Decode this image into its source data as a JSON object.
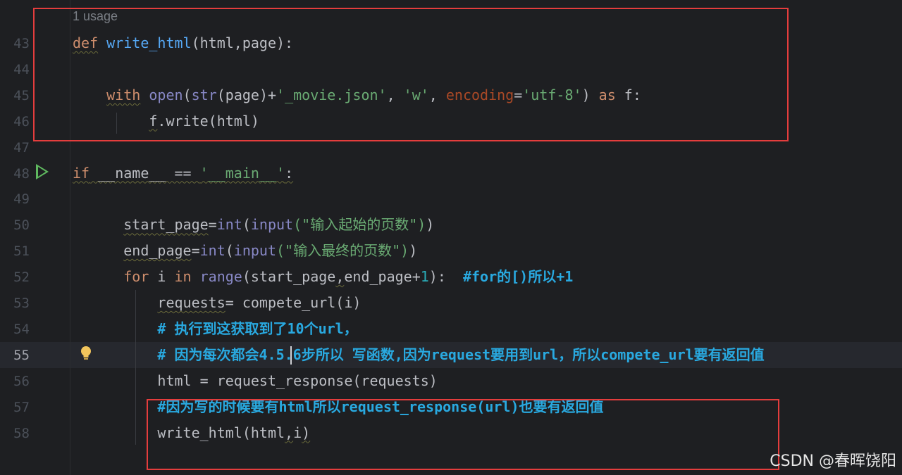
{
  "editor": {
    "usage_hint": "1 usage",
    "lines": [
      {
        "num": "43",
        "tokens": [
          {
            "t": "def",
            "c": "kw squig"
          },
          {
            "t": " "
          },
          {
            "t": "write_html",
            "c": "fn"
          },
          {
            "t": "(html,page):"
          }
        ]
      },
      {
        "num": "44",
        "tokens": []
      },
      {
        "num": "45",
        "tokens": [
          {
            "t": "    "
          },
          {
            "t": "with",
            "c": "kw squig"
          },
          {
            "t": " "
          },
          {
            "t": "open",
            "c": "bi"
          },
          {
            "t": "("
          },
          {
            "t": "str",
            "c": "bi"
          },
          {
            "t": "(page)+"
          },
          {
            "t": "'_movie.json'",
            "c": "str"
          },
          {
            "t": ", "
          },
          {
            "t": "'w'",
            "c": "str"
          },
          {
            "t": ", "
          },
          {
            "t": "encoding",
            "c": "param"
          },
          {
            "t": "="
          },
          {
            "t": "'utf-8'",
            "c": "str"
          },
          {
            "t": ") "
          },
          {
            "t": "as",
            "c": "kw"
          },
          {
            "t": " f:"
          }
        ]
      },
      {
        "num": "46",
        "tokens": [
          {
            "t": "         "
          },
          {
            "t": "f",
            "c": "squig"
          },
          {
            "t": ".write(html)"
          }
        ]
      },
      {
        "num": "47",
        "tokens": []
      },
      {
        "num": "48",
        "tokens": [
          {
            "t": "if",
            "c": "kw squig"
          },
          {
            "t": " __name__ == ",
            "c": "squig"
          },
          {
            "t": "'__main__'",
            "c": "str squig"
          },
          {
            "t": ":",
            "c": "squig"
          }
        ]
      },
      {
        "num": "49",
        "tokens": []
      },
      {
        "num": "50",
        "tokens": [
          {
            "t": "      "
          },
          {
            "t": "start_page",
            "c": "squig"
          },
          {
            "t": "="
          },
          {
            "t": "int",
            "c": "bi"
          },
          {
            "t": "("
          },
          {
            "t": "input",
            "c": "bi"
          },
          {
            "t": "(\"输入起始的页数\")",
            "c": "str"
          },
          {
            "t": ")"
          }
        ]
      },
      {
        "num": "51",
        "tokens": [
          {
            "t": "      "
          },
          {
            "t": "end_page",
            "c": "squig"
          },
          {
            "t": "="
          },
          {
            "t": "int",
            "c": "bi"
          },
          {
            "t": "("
          },
          {
            "t": "input",
            "c": "bi"
          },
          {
            "t": "(\"输入最终的页数\")",
            "c": "str"
          },
          {
            "t": ")"
          }
        ]
      },
      {
        "num": "52",
        "tokens": [
          {
            "t": "      "
          },
          {
            "t": "for",
            "c": "kw"
          },
          {
            "t": " i "
          },
          {
            "t": "in",
            "c": "kw"
          },
          {
            "t": " "
          },
          {
            "t": "range",
            "c": "bi"
          },
          {
            "t": "(start_page"
          },
          {
            "t": ",",
            "c": "squig"
          },
          {
            "t": "end_page+"
          },
          {
            "t": "1",
            "c": "num"
          },
          {
            "t": "):  "
          },
          {
            "t": "#for的[)所以+1",
            "c": "cm"
          }
        ]
      },
      {
        "num": "53",
        "tokens": [
          {
            "t": "          "
          },
          {
            "t": "requests",
            "c": "squig"
          },
          {
            "t": "= compete_url(i)"
          }
        ]
      },
      {
        "num": "54",
        "tokens": [
          {
            "t": "          "
          },
          {
            "t": "# 执行到这获取到了10个url，",
            "c": "cm"
          }
        ]
      },
      {
        "num": "55",
        "tokens": [
          {
            "t": "          "
          },
          {
            "t": "# 因为每次都会4.5.6步所以 写函数,因为request要用到url，所以compete_url要有返回值",
            "c": "cm"
          }
        ]
      },
      {
        "num": "56",
        "tokens": [
          {
            "t": "          "
          },
          {
            "t": "html = request_response(requests)"
          }
        ]
      },
      {
        "num": "57",
        "tokens": [
          {
            "t": "          "
          },
          {
            "t": "#因为写的时候要有html所以request_response(url)也要有返回值",
            "c": "cm"
          }
        ]
      },
      {
        "num": "58",
        "tokens": [
          {
            "t": "          "
          },
          {
            "t": "write_html(html"
          },
          {
            "t": ",",
            "c": "squig"
          },
          {
            "t": "i"
          },
          {
            "t": ")",
            "c": "squig"
          }
        ]
      }
    ],
    "active_line": "55"
  },
  "watermark": "CSDN @春晖饶阳",
  "colors": {
    "highlight_box": "#e43d3d",
    "background": "#1e1f22"
  }
}
